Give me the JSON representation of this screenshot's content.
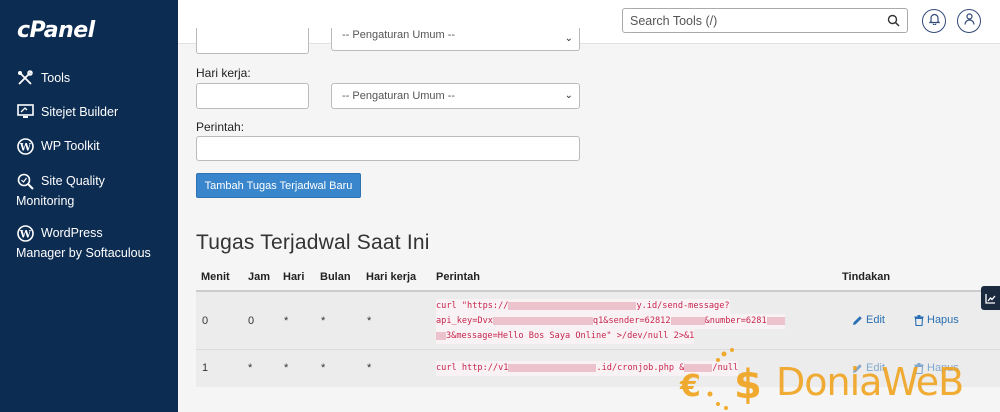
{
  "sidebar": {
    "logo": "cPanel",
    "items": [
      {
        "label": "Tools",
        "icon": "tools-icon"
      },
      {
        "label": "Sitejet Builder",
        "icon": "monitor-icon"
      },
      {
        "label": "WP Toolkit",
        "icon": "wordpress-icon"
      },
      {
        "label": "Site Quality Monitoring",
        "icon": "search-quality-icon"
      },
      {
        "label": "WordPress Manager by Softaculous",
        "icon": "wordpress-icon"
      }
    ]
  },
  "header": {
    "search_placeholder": "Search Tools (/)"
  },
  "form": {
    "common_select": "-- Pengaturan Umum --",
    "weekday_label": "Hari kerja:",
    "weekday_select": "-- Pengaturan Umum --",
    "command_label": "Perintah:",
    "command_value": "",
    "add_button": "Tambah Tugas Terjadwal Baru"
  },
  "section_title": "Tugas Terjadwal Saat Ini",
  "table": {
    "headers": [
      "Menit",
      "Jam",
      "Hari",
      "Bulan",
      "Hari kerja",
      "Perintah",
      "Tindakan"
    ],
    "rows": [
      {
        "minute": "0",
        "hour": "0",
        "day": "*",
        "month": "*",
        "weekday": "*",
        "command_lines": [
          [
            "curl \"https://",
            "y.id/send-message?"
          ],
          [
            "api_key=Dvx",
            "q1&sender=62812",
            "&number=6281"
          ],
          [
            "3&message=Hello Bos Saya Online\" >/dev/null 2>&1"
          ]
        ],
        "edit": "Edit",
        "delete": "Hapus"
      },
      {
        "minute": "1",
        "hour": "*",
        "day": "*",
        "month": "*",
        "weekday": "*",
        "command_lines": [
          [
            "curl http://v1",
            ".id/cronjob.php &",
            "/null"
          ]
        ],
        "edit": "Edit",
        "delete": "Hapus"
      }
    ]
  },
  "watermark": {
    "text": "DoniaWeB"
  },
  "colors": {
    "sidebar_bg": "#0d2c52",
    "primary": "#3a86cc",
    "link": "#2a6fb3",
    "code": "#c7254e",
    "watermark": "#f0a21a"
  }
}
